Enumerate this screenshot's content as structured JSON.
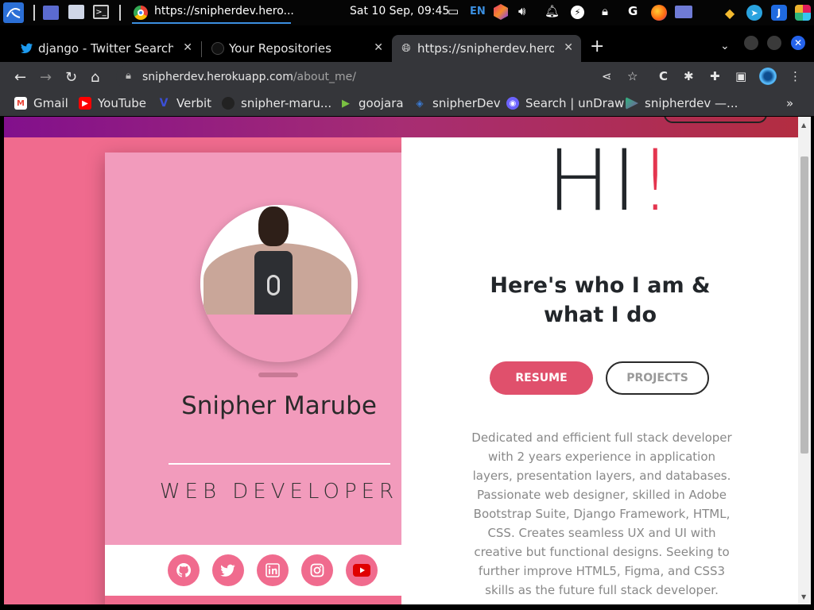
{
  "taskbar": {
    "task_label": "https://snipherdev.hero...",
    "clock": "Sat 10 Sep, 09:45",
    "language": "EN"
  },
  "tabs": [
    {
      "title": "django - Twitter Search / T",
      "icon": "twitter-icon",
      "close": "✕"
    },
    {
      "title": "Your Repositories",
      "icon": "github-icon",
      "close": "✕"
    },
    {
      "title": "https://snipherdev.herokuapp.com/about_me/",
      "icon": "globe-icon",
      "close": "✕"
    }
  ],
  "newtab": "+",
  "omnibox": {
    "host": "snipherdev.herokuapp.com",
    "path": "/about_me/"
  },
  "bookmarks": [
    {
      "label": "Gmail",
      "icon": "gmail-icon",
      "color": "#ea4335"
    },
    {
      "label": "YouTube",
      "icon": "youtube-icon",
      "color": "#ff0000"
    },
    {
      "label": "Verbit",
      "icon": "verbit-icon",
      "color": "#3b4fd6"
    },
    {
      "label": "snipher-maru...",
      "icon": "github-icon",
      "color": "#222222"
    },
    {
      "label": "goojara",
      "icon": "play-icon",
      "color": "#7ac142"
    },
    {
      "label": "snipherDev",
      "icon": "code-icon",
      "color": "#3a7bd5"
    },
    {
      "label": "Search | unDraw",
      "icon": "undraw-icon",
      "color": "#6c63ff"
    },
    {
      "label": "snipherdev —...",
      "icon": "heroku-icon",
      "color": "#79589f"
    }
  ],
  "bookmarks_more": "»",
  "page": {
    "colors": {
      "accent": "#e4354f",
      "panel_pink": "#f06b8e",
      "card_pink": "#f29bbc",
      "button_pink": "#e0506c"
    },
    "hi_text": "HI",
    "hi_bang": "!",
    "lead": "Here's who I am & what I do",
    "name": "Snipher Marube",
    "role": "WEB DEVELOPER",
    "resume_label": "RESUME",
    "projects_label": "PROJECTS",
    "bio": "Dedicated and efficient full stack developer with 2 years experience in application layers, presentation layers, and databases. Passionate web designer, skilled in Adobe Bootstrap Suite, Django Framework, HTML, CSS. Creates seamless UX and UI with creative but functional designs. Seeking to further improve HTML5, Figma, and CSS3 skills as the future full stack developer.",
    "social": [
      "github-icon",
      "twitter-icon",
      "linkedin-icon",
      "instagram-icon",
      "youtube-icon"
    ]
  }
}
